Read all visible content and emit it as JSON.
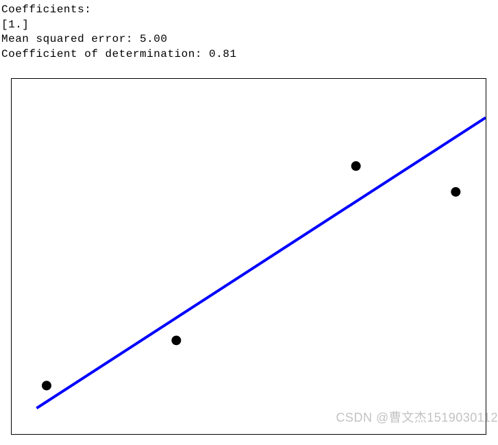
{
  "output": {
    "coefficients_label": "Coefficients:",
    "coefficients_value": " [1.]",
    "mse_line": "Mean squared error: 5.00",
    "r2_line": "Coefficient of determination: 0.81"
  },
  "watermark": "CSDN @曹文杰1519030112",
  "chart_data": {
    "type": "scatter",
    "series": [
      {
        "name": "regression-line",
        "kind": "line",
        "x": [
          1,
          10
        ],
        "y": [
          1,
          10
        ],
        "color": "#0000ff"
      },
      {
        "name": "data-points",
        "kind": "scatter",
        "x": [
          1.2,
          3.8,
          7.4,
          9.4
        ],
        "y": [
          1.7,
          3.1,
          8.5,
          7.7
        ],
        "color": "#000000"
      }
    ],
    "xlim": [
      0.5,
      10.0
    ],
    "ylim": [
      0.2,
      11.2
    ],
    "xlabel": "",
    "ylabel": "",
    "title": "",
    "grid": false,
    "legend": false
  }
}
